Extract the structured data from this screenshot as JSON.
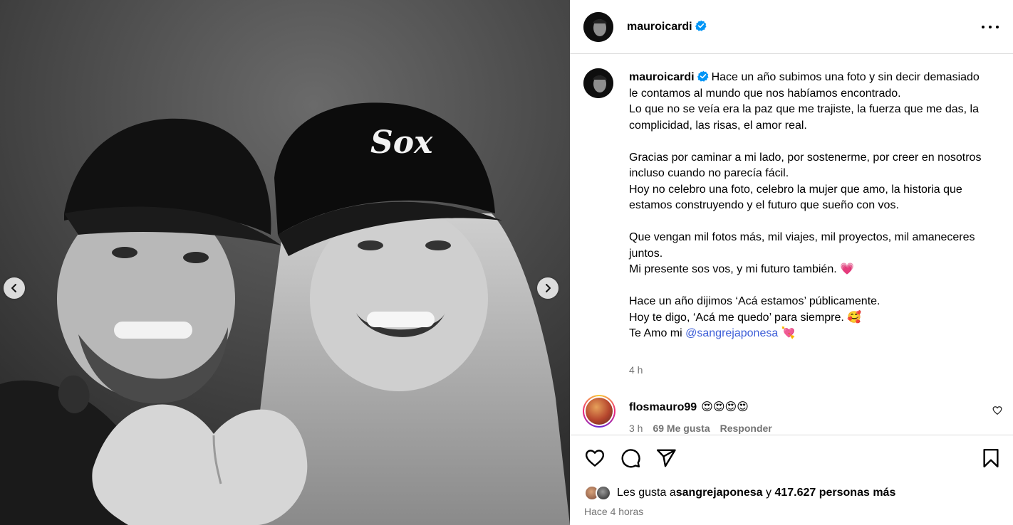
{
  "post": {
    "username": "mauroicardi",
    "more_icon": "more-horizontal-icon"
  },
  "caption": {
    "username": "mauroicardi",
    "text": "Hace un año subimos una foto y sin decir demasiado le contamos al mundo que nos habíamos encontrado.\nLo que no se veía era la paz que me trajiste, la fuerza que me das, la complicidad, las risas, el amor real.\n\nGracias por caminar a mi lado, por sostenerme, por creer en nosotros incluso cuando no parecía fácil.\nHoy no celebro una foto, celebro la mujer que amo, la historia que estamos construyendo y el futuro que sueño con vos.\n\nQue vengan mil fotos más, mil viajes, mil proyectos, mil amaneceres juntos.\nMi presente sos vos, y mi futuro también. 💗\n\nHace un año dijimos ‘Acá estamos’ públicamente.\nHoy te digo, ‘Acá me quedo’ para siempre. 🥰\nTe Amo mi ",
    "mention": "@sangrejaponesa",
    "tail_emoji": "💘",
    "time": "4 h"
  },
  "comment": {
    "username": "flosmauro99",
    "text": "😍😍😍😍",
    "time": "3 h",
    "likes": "69 Me gusta",
    "reply": "Responder"
  },
  "likes": {
    "prefix": "Les gusta a ",
    "user": "sangrejaponesa",
    "joiner": " y ",
    "count": "417.627 personas más"
  },
  "timestamp": "Hace 4 horas",
  "photo": {
    "cap_logo": "Sox"
  },
  "colors": {
    "accent_link": "#3d5ed7",
    "verified": "#0095f6",
    "secondary_text": "#737373",
    "divider": "#dbdbdb"
  }
}
